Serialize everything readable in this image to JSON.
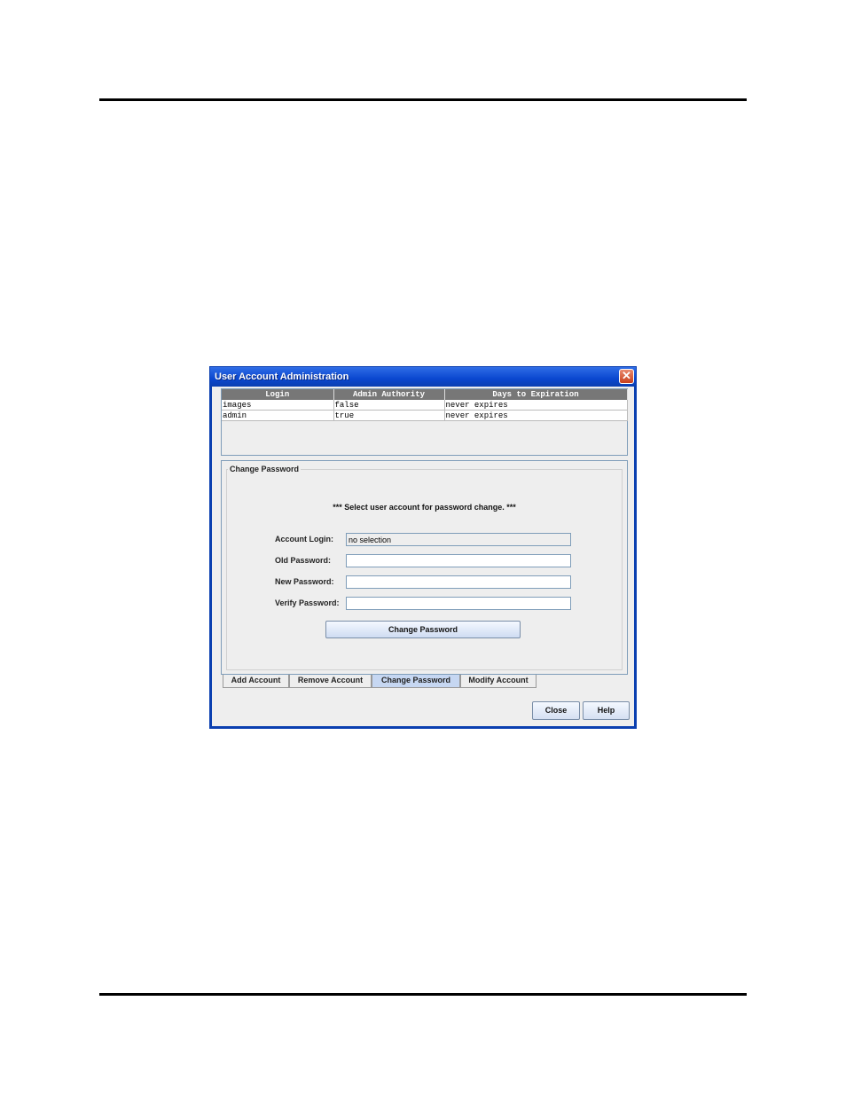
{
  "window": {
    "title": "User Account Administration",
    "close_glyph": "✕"
  },
  "table": {
    "columns": [
      "Login",
      "Admin Authority",
      "Days to Expiration"
    ],
    "rows": [
      [
        "images",
        "false",
        "never expires"
      ],
      [
        "admin",
        "true",
        "never expires"
      ]
    ]
  },
  "panel": {
    "legend": "Change Password",
    "instruction": "*** Select user account for password change. ***",
    "fields": {
      "account_login_label": "Account Login:",
      "account_login_value": "no selection",
      "old_password_label": "Old Password:",
      "new_password_label": "New Password:",
      "verify_password_label": "Verify Password:"
    },
    "change_button": "Change Password"
  },
  "tabs": [
    "Add Account",
    "Remove Account",
    "Change Password",
    "Modify Account"
  ],
  "active_tab": "Change Password",
  "buttons": {
    "close": "Close",
    "help": "Help"
  }
}
